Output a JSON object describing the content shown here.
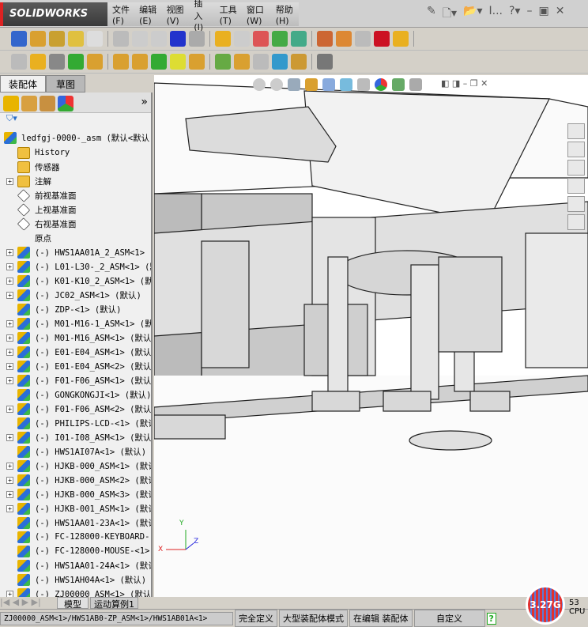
{
  "app": {
    "logo": "SOLIDWORKS"
  },
  "menu": [
    "文件(F)",
    "编辑(E)",
    "视图(V)",
    "插入(I)",
    "工具(T)",
    "窗口(W)",
    "帮助(H)"
  ],
  "title_ellipsis": "I...",
  "tabs": {
    "assembly": "装配体",
    "sketch": "草图"
  },
  "tree": {
    "root": "ledfgj-0000-_asm (默认<默认",
    "items": [
      {
        "label": "History",
        "icon": "history-folder-icon",
        "plus": false
      },
      {
        "label": "传感器",
        "icon": "sensor-folder-icon",
        "plus": false
      },
      {
        "label": "注解",
        "icon": "annotation-folder-icon",
        "plus": true
      },
      {
        "label": "前视基准面",
        "icon": "plane-icon",
        "plus": false
      },
      {
        "label": "上视基准面",
        "icon": "plane-icon",
        "plus": false
      },
      {
        "label": "右视基准面",
        "icon": "plane-icon",
        "plus": false
      },
      {
        "label": "原点",
        "icon": "origin-icon",
        "plus": false
      },
      {
        "label": "(-) HWS1AA01A_2_ASM<1> (默",
        "icon": "subassembly-icon",
        "plus": true
      },
      {
        "label": "(-) L01-L30-_2_ASM<1> (默认",
        "icon": "subassembly-icon",
        "plus": true
      },
      {
        "label": "(-) K01-K10_2_ASM<1> (默认",
        "icon": "subassembly-icon",
        "plus": true
      },
      {
        "label": "(-) JC02_ASM<1> (默认)",
        "icon": "subassembly-icon",
        "plus": true
      },
      {
        "label": "(-) ZDP-<1> (默认)",
        "icon": "part-icon",
        "plus": false
      },
      {
        "label": "(-) M01-M16-1_ASM<1> (默认",
        "icon": "subassembly-icon",
        "plus": true
      },
      {
        "label": "(-) M01-M16_ASM<1> (默认)",
        "icon": "subassembly-icon",
        "plus": true
      },
      {
        "label": "(-) E01-E04_ASM<1> (默认)",
        "icon": "subassembly-icon",
        "plus": true
      },
      {
        "label": "(-) E01-E04_ASM<2> (默认)",
        "icon": "subassembly-icon",
        "plus": true
      },
      {
        "label": "(-) F01-F06_ASM<1> (默认)",
        "icon": "subassembly-icon",
        "plus": true
      },
      {
        "label": "(-) GONGKONGJI<1> (默认)",
        "icon": "part-icon",
        "plus": false
      },
      {
        "label": "(-) F01-F06_ASM<2> (默认)",
        "icon": "subassembly-icon",
        "plus": true
      },
      {
        "label": "(-) PHILIPS-LCD-<1> (默认",
        "icon": "part-icon",
        "plus": false
      },
      {
        "label": "(-) I01-I08_ASM<1> (默认)",
        "icon": "subassembly-icon",
        "plus": true
      },
      {
        "label": "(-) HWS1AI07A<1> (默认)",
        "icon": "part-icon",
        "plus": false
      },
      {
        "label": "(-) HJKB-000_ASM<1> (默认",
        "icon": "subassembly-icon",
        "plus": true
      },
      {
        "label": "(-) HJKB-000_ASM<2> (默认",
        "icon": "subassembly-icon",
        "plus": true
      },
      {
        "label": "(-) HJKB-000_ASM<3> (默认",
        "icon": "subassembly-icon",
        "plus": true
      },
      {
        "label": "(-) HJKB-001_ASM<1> (默认",
        "icon": "subassembly-icon",
        "plus": true
      },
      {
        "label": "(-) HWS1AA01-23A<1> (默认",
        "icon": "part-icon",
        "plus": false
      },
      {
        "label": "(-) FC-128000-KEYBOARD--<",
        "icon": "part-icon",
        "plus": false
      },
      {
        "label": "(-) FC-128000-MOUSE-<1>",
        "icon": "part-icon",
        "plus": false
      },
      {
        "label": "(-) HWS1AA01-24A<1> (默认",
        "icon": "part-icon",
        "plus": false
      },
      {
        "label": "(-) HWS1AH04A<1> (默认)",
        "icon": "part-icon",
        "plus": false
      },
      {
        "label": "(-) ZJ00000_ASM<1> (默认",
        "icon": "subassembly-icon",
        "plus": true
      }
    ]
  },
  "bottom_tabs": {
    "model": "模型",
    "motion": "运动算例1"
  },
  "status": {
    "path": "ZJ00000_ASM<1>/HWS1AB0-ZP_ASM<1>/HWS1AB01A<1>",
    "defined": "完全定义",
    "mode": "大型装配体模式",
    "editing": "在编辑 装配体",
    "custom": "自定义"
  },
  "memory": "3.27G",
  "cpu": {
    "value": "53",
    "label": "CPU"
  },
  "triad": {
    "x": "X",
    "y": "Y",
    "z": "Z"
  },
  "colors": {
    "accent": "#d22020",
    "tree_bg": "#f0f0f0"
  }
}
